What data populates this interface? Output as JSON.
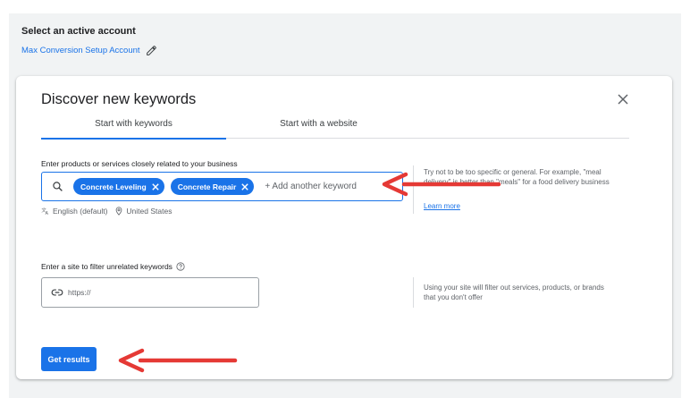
{
  "account": {
    "heading": "Select an active account",
    "name": "Max Conversion Setup Account"
  },
  "dialog": {
    "title": "Discover new keywords",
    "tabs": [
      {
        "label": "Start with keywords",
        "active": true
      },
      {
        "label": "Start with a website",
        "active": false
      }
    ],
    "keywords": {
      "label": "Enter products or services closely related to your business",
      "chips": [
        "Concrete Leveling",
        "Concrete Repair"
      ],
      "placeholder": "+ Add another keyword",
      "language": "English (default)",
      "location": "United States",
      "hint": "Try not to be too specific or general. For example, \"meal delivery\" is better than \"meals\" for a food delivery business",
      "learn_more": "Learn more"
    },
    "site": {
      "label": "Enter a site to filter unrelated keywords",
      "placeholder": "https://",
      "hint": "Using your site will filter out services, products, or brands that you don't offer"
    },
    "submit_label": "Get results"
  },
  "colors": {
    "accent": "#1a73e8",
    "annotation_arrow": "#e53935"
  },
  "icons": [
    "pencil-icon",
    "close-icon",
    "search-icon",
    "chip-remove-icon",
    "translate-icon",
    "location-pin-icon",
    "help-icon",
    "link-icon",
    "annotation-arrow"
  ]
}
